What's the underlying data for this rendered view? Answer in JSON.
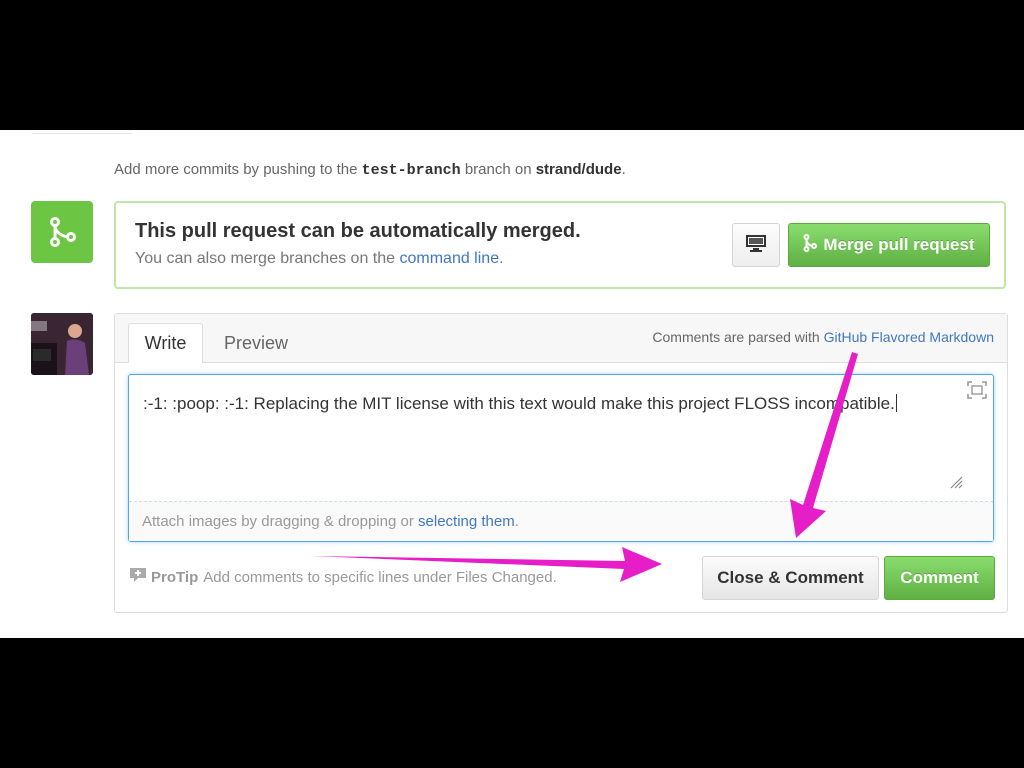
{
  "commits_hint": {
    "prefix": "Add more commits by pushing to the",
    "branch": "test-branch",
    "middle": "branch on",
    "repo": "strand/dude",
    "suffix": "."
  },
  "merge": {
    "icon": "git-merge-icon",
    "title": "This pull request can be automatically merged.",
    "subtitle_prefix": "You can also merge branches on the",
    "subtitle_link": "command line",
    "subtitle_suffix": ".",
    "monitor_icon": "desktop-monitor-icon",
    "button_label": "Merge pull request",
    "accent": "#6cc644"
  },
  "comment": {
    "tabs": {
      "write": "Write",
      "preview": "Preview"
    },
    "markdown_prefix": "Comments are parsed with",
    "markdown_link": "GitHub Flavored Markdown",
    "editor_text": ":-1: :poop: :-1: Replacing the MIT license with this text would make this project FLOSS incompatible.",
    "attach_prefix": "Attach images by dragging & dropping or",
    "attach_link": "selecting them",
    "attach_suffix": ".",
    "protip_label": "ProTip",
    "protip_text": "Add comments to specific lines under Files Changed.",
    "close_button": "Close & Comment",
    "comment_button": "Comment"
  },
  "colors": {
    "link": "#4078c0",
    "green": "#6cc644",
    "annotation_arrow": "#e61ec8"
  }
}
